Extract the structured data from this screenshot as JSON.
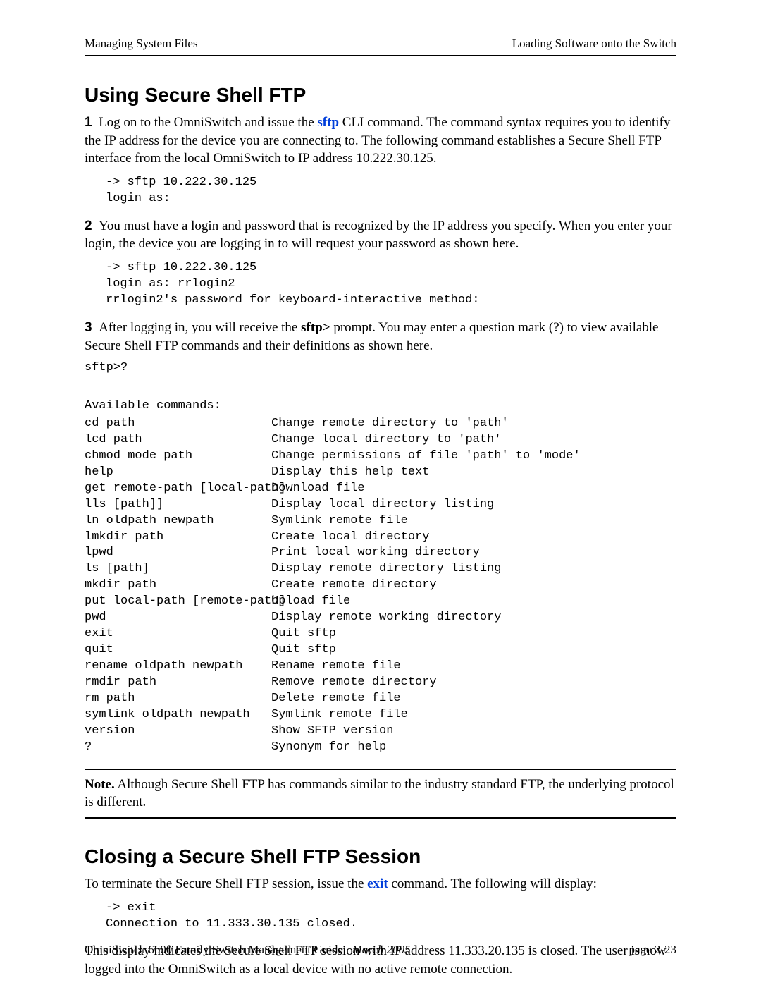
{
  "header": {
    "left": "Managing System Files",
    "right": "Loading Software onto the Switch"
  },
  "section1": {
    "title": "Using Secure Shell FTP",
    "step1_num": "1",
    "step1_text_a": "Log on to the OmniSwitch and issue the ",
    "step1_cmd": "sftp",
    "step1_text_b": " CLI command. The command syntax requires you to identify the IP address for the device you are connecting to. The following command establishes a Secure Shell FTP interface from the local OmniSwitch to IP address 10.222.30.125.",
    "code1": "-> sftp 10.222.30.125\nlogin as:",
    "step2_num": "2",
    "step2_text": "You must have a login and password that is recognized by the IP address you specify. When you enter your login, the device you are logging in to will request your password as shown here.",
    "code2": "-> sftp 10.222.30.125\nlogin as: rrlogin2\nrrlogin2's password for keyboard-interactive method:",
    "step3_num": "3",
    "step3_text_a": "After logging in, you will receive the ",
    "step3_bold": "sftp>",
    "step3_text_b": " prompt. You may enter a question mark (?) to view available Secure Shell FTP commands and their definitions as shown here.",
    "code3_header": "sftp>?",
    "code3_blank": " ",
    "code3_avail": "Available commands:",
    "commands": [
      {
        "c": "cd path",
        "d": "Change remote directory to 'path'"
      },
      {
        "c": "lcd path",
        "d": "Change local directory to 'path'"
      },
      {
        "c": "chmod mode path",
        "d": "Change permissions of file 'path' to 'mode'"
      },
      {
        "c": "help",
        "d": "Display this help text"
      },
      {
        "c": "get remote-path [local-path]",
        "d": "Download file"
      },
      {
        "c": "lls [path]]",
        "d": "Display local directory listing"
      },
      {
        "c": "ln oldpath newpath",
        "d": "Symlink remote file"
      },
      {
        "c": "lmkdir path",
        "d": "Create local directory"
      },
      {
        "c": "lpwd",
        "d": "Print local working directory"
      },
      {
        "c": "ls [path]",
        "d": "Display remote directory listing"
      },
      {
        "c": "mkdir path",
        "d": "Create remote directory"
      },
      {
        "c": "put local-path [remote-path]",
        "d": "Upload file"
      },
      {
        "c": "pwd",
        "d": "Display remote working directory"
      },
      {
        "c": "exit",
        "d": "Quit sftp"
      },
      {
        "c": "quit",
        "d": "Quit sftp"
      },
      {
        "c": "rename oldpath newpath",
        "d": "Rename remote file"
      },
      {
        "c": "rmdir path",
        "d": "Remove remote directory"
      },
      {
        "c": "rm path",
        "d": "Delete remote file"
      },
      {
        "c": "symlink oldpath newpath",
        "d": "Symlink remote file"
      },
      {
        "c": "version",
        "d": "Show SFTP version"
      },
      {
        "c": "?",
        "d": "Synonym for help"
      }
    ],
    "note_label": "Note.",
    "note_text": " Although Secure Shell FTP has commands similar to the industry standard FTP, the underlying protocol is different."
  },
  "section2": {
    "title": "Closing a Secure Shell FTP Session",
    "p1_a": "To terminate the Secure Shell FTP session, issue the ",
    "p1_cmd": "exit",
    "p1_b": " command. The following will display:",
    "code": "-> exit\nConnection to 11.333.30.135 closed.",
    "p2": "This display indicates the Secure Shell FTP session with IP address 11.333.20.135 is closed. The user is now logged into the OmniSwitch as a local device with no active remote connection."
  },
  "footer": {
    "guide": "OmniSwitch 6600 Family Switch Management Guide",
    "date": "March 2005",
    "page": "page 2-23"
  }
}
